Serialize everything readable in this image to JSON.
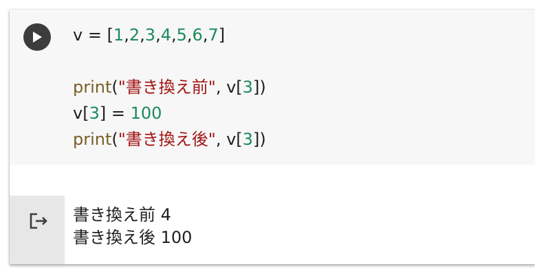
{
  "cell": {
    "run_button_icon": "play-icon",
    "output_icon": "output-arrow-icon",
    "code_lines": [
      {
        "tokens": [
          {
            "t": "v = [",
            "c": "plain"
          },
          {
            "t": "1",
            "c": "num"
          },
          {
            "t": ",",
            "c": "plain"
          },
          {
            "t": "2",
            "c": "num"
          },
          {
            "t": ",",
            "c": "plain"
          },
          {
            "t": "3",
            "c": "num"
          },
          {
            "t": ",",
            "c": "plain"
          },
          {
            "t": "4",
            "c": "num"
          },
          {
            "t": ",",
            "c": "plain"
          },
          {
            "t": "5",
            "c": "num"
          },
          {
            "t": ",",
            "c": "plain"
          },
          {
            "t": "6",
            "c": "num"
          },
          {
            "t": ",",
            "c": "plain"
          },
          {
            "t": "7",
            "c": "num"
          },
          {
            "t": "]",
            "c": "plain"
          }
        ]
      },
      {
        "tokens": []
      },
      {
        "tokens": [
          {
            "t": "print",
            "c": "fn"
          },
          {
            "t": "(",
            "c": "plain"
          },
          {
            "t": "\"書き換え前\"",
            "c": "str"
          },
          {
            "t": ", v[",
            "c": "plain"
          },
          {
            "t": "3",
            "c": "num"
          },
          {
            "t": "])",
            "c": "plain"
          }
        ]
      },
      {
        "tokens": [
          {
            "t": "v[",
            "c": "plain"
          },
          {
            "t": "3",
            "c": "num"
          },
          {
            "t": "] = ",
            "c": "plain"
          },
          {
            "t": "100",
            "c": "num"
          }
        ]
      },
      {
        "tokens": [
          {
            "t": "print",
            "c": "fn"
          },
          {
            "t": "(",
            "c": "plain"
          },
          {
            "t": "\"書き換え後\"",
            "c": "str"
          },
          {
            "t": ", v[",
            "c": "plain"
          },
          {
            "t": "3",
            "c": "num"
          },
          {
            "t": "])",
            "c": "plain"
          }
        ]
      }
    ],
    "output_lines": [
      "書き換え前 4",
      "書き換え後 100"
    ]
  },
  "colors": {
    "code_bg": "#f7f7f7",
    "gutter_bg": "#e7e7e7",
    "number": "#1b8a5a",
    "function": "#795e26",
    "string": "#a31515",
    "text": "#1f1f1f"
  }
}
